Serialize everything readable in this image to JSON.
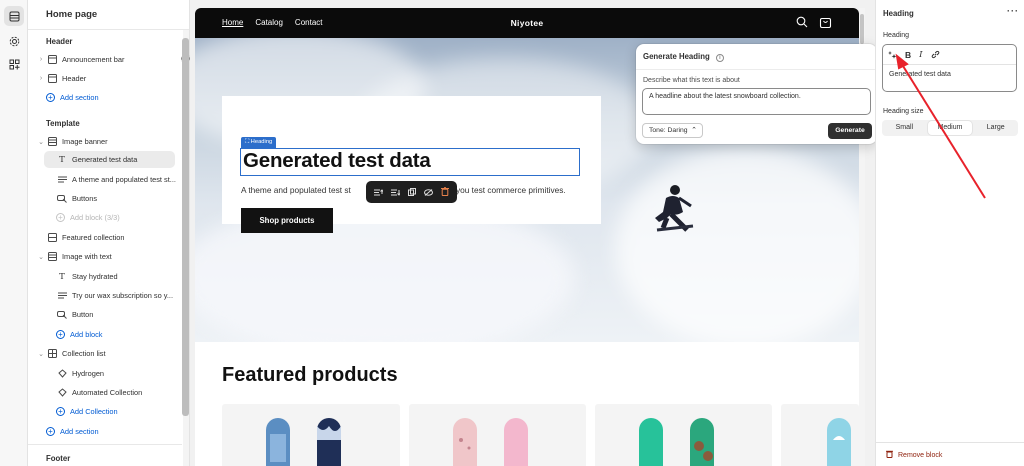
{
  "sidebar": {
    "page_title": "Home page",
    "header_section": "Header",
    "header_items": [
      {
        "label": "Announcement bar",
        "icon": "layout-icon"
      },
      {
        "label": "Header",
        "icon": "layout-icon"
      }
    ],
    "add_section_1": "Add section",
    "template_section": "Template",
    "image_banner": "Image banner",
    "image_banner_blocks": [
      {
        "label": "Generated test data",
        "icon": "text-icon"
      },
      {
        "label": "A theme and populated test st...",
        "icon": "paragraph-icon"
      },
      {
        "label": "Buttons",
        "icon": "button-icon"
      }
    ],
    "add_block_disabled": "Add block (3/3)",
    "featured_collection": "Featured collection",
    "image_with_text": "Image with text",
    "image_with_text_blocks": [
      {
        "label": "Stay hydrated",
        "icon": "text-icon"
      },
      {
        "label": "Try our wax subscription so y...",
        "icon": "paragraph-icon"
      },
      {
        "label": "Button",
        "icon": "button-icon"
      }
    ],
    "add_block": "Add block",
    "collection_list": "Collection list",
    "collection_list_blocks": [
      {
        "label": "Hydrogen",
        "icon": "collection-icon"
      },
      {
        "label": "Automated Collection",
        "icon": "collection-icon"
      }
    ],
    "add_collection": "Add Collection",
    "add_section_2": "Add section",
    "footer_section": "Footer"
  },
  "preview": {
    "nav_links": [
      "Home",
      "Catalog",
      "Contact"
    ],
    "brand": "Niyotee",
    "block_tag": "Heading",
    "heading": "Generated test data",
    "subtext_a": "A theme and populated test st",
    "subtext_b": "you test commerce primitives.",
    "shop_button": "Shop products",
    "featured_title": "Featured products"
  },
  "generate_popup": {
    "title": "Generate Heading",
    "describe_label": "Describe what this text is about",
    "describe_value": "A headline about the latest snowboard collection.",
    "tone_label": "Tone: Daring",
    "generate_button": "Generate"
  },
  "right_panel": {
    "title": "Heading",
    "field_label": "Heading",
    "editor_value": "Generated test data",
    "size_label": "Heading size",
    "size_options": [
      "Small",
      "Medium",
      "Large"
    ],
    "size_selected": "Medium",
    "remove_block": "Remove block"
  },
  "colors": {
    "accent": "#005bd3",
    "selection": "#2c6ecb",
    "annotation_arrow": "#e8222b",
    "danger": "#8e1f0b"
  }
}
